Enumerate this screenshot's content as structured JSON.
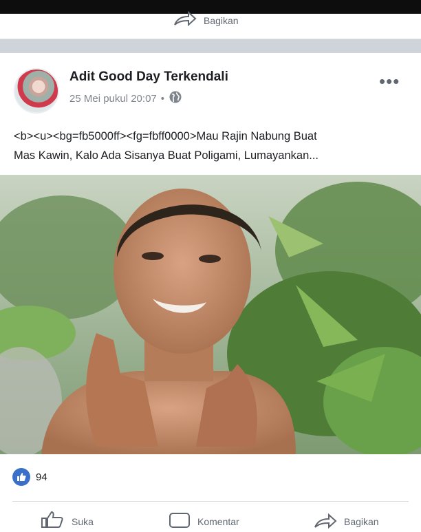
{
  "previous_post": {
    "share_label": "Bagikan"
  },
  "post": {
    "author": "Adit Good Day Terkendali",
    "date": "25 Mei pukul 20:07",
    "separator_dot": "•",
    "privacy_icon": "globe-icon",
    "more_icon": "more-options-icon",
    "text_line1": "<b><u><bg=fb5000ff><fg=fbff0000>Mau Rajin Nabung Buat",
    "text_line2": "Mas Kawin, Kalo Ada Sisanya Buat Poligami, Lumayankan..."
  },
  "reactions": {
    "icon": "like-icon",
    "count": "94"
  },
  "actions": [
    {
      "label": "Suka",
      "icon": "like-outline-icon"
    },
    {
      "label": "Komentar",
      "icon": "comment-icon"
    },
    {
      "label": "Bagikan",
      "icon": "share-icon"
    }
  ],
  "colors": {
    "like_blue": "#3b70c8",
    "meta_gray": "#7f858b",
    "separator": "#cfd4da"
  }
}
